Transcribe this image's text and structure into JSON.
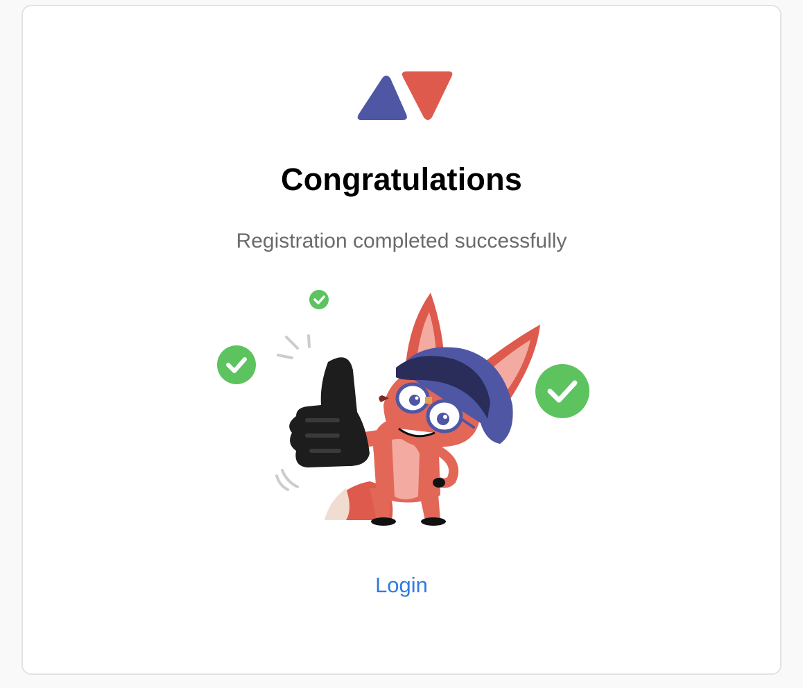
{
  "brand": {
    "logo_icon": "brand-logo-icon",
    "colors": {
      "left_triangle": "#4f56a3",
      "right_triangle": "#dd5a4d"
    }
  },
  "header": {
    "title": "Congratulations",
    "subtitle": "Registration completed successfully"
  },
  "illustration": {
    "icon": "fox-thumbs-up-illustration",
    "check_icon": "check-circle-icon",
    "check_color": "#5cc35f"
  },
  "actions": {
    "login_label": "Login",
    "link_color": "#2f7be0"
  }
}
